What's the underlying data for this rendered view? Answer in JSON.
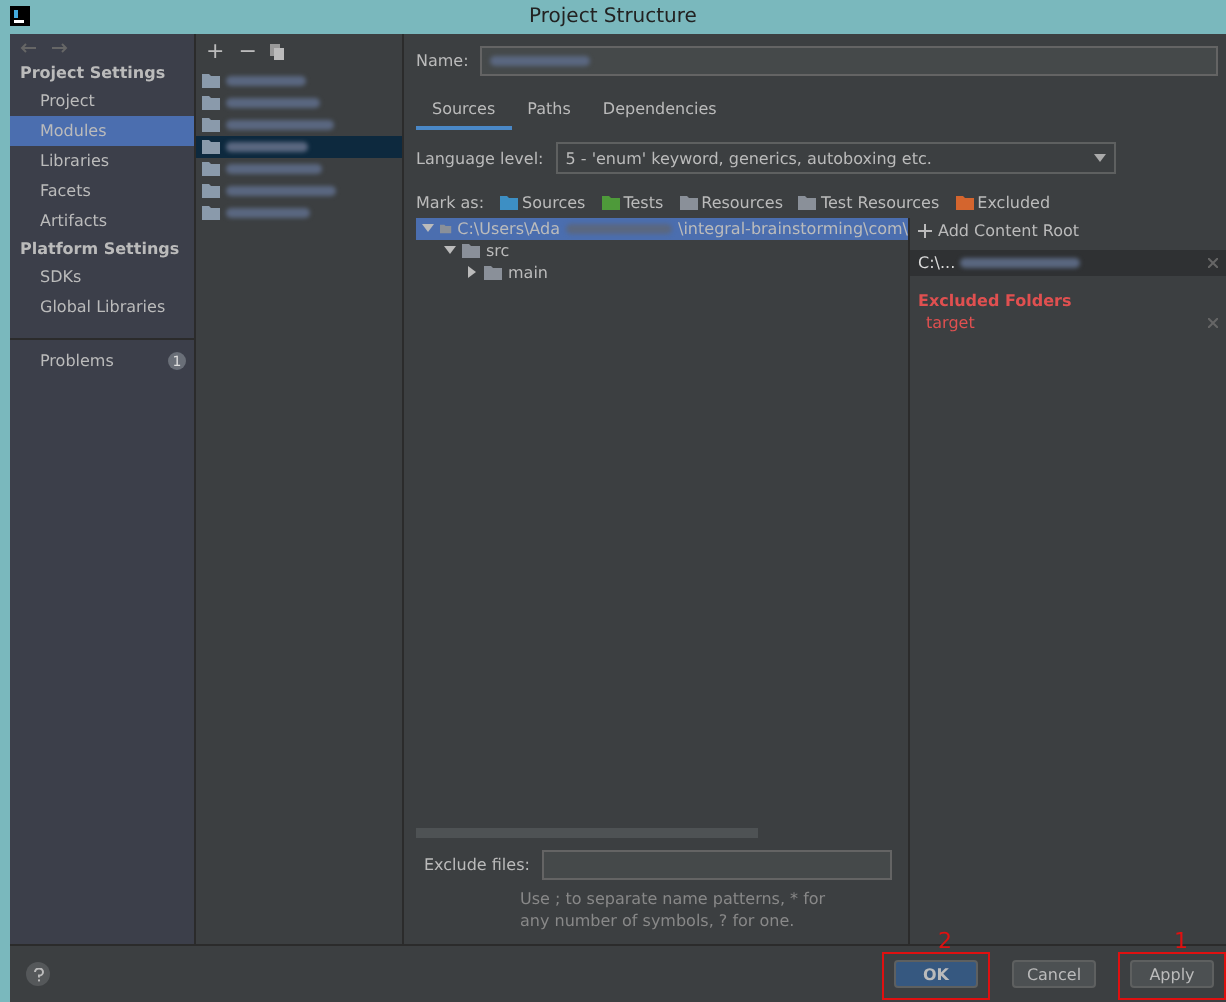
{
  "window": {
    "title": "Project Structure"
  },
  "sidebar": {
    "sections": [
      {
        "title": "Project Settings",
        "items": [
          {
            "label": "Project",
            "selected": false
          },
          {
            "label": "Modules",
            "selected": true
          },
          {
            "label": "Libraries",
            "selected": false
          },
          {
            "label": "Facets",
            "selected": false
          },
          {
            "label": "Artifacts",
            "selected": false
          }
        ]
      },
      {
        "title": "Platform Settings",
        "items": [
          {
            "label": "SDKs",
            "selected": false
          },
          {
            "label": "Global Libraries",
            "selected": false
          }
        ]
      }
    ],
    "problems": {
      "label": "Problems",
      "count": "1"
    }
  },
  "modules": {
    "toolbar": [
      "+",
      "−"
    ],
    "items": [
      {
        "selected": false
      },
      {
        "selected": false
      },
      {
        "selected": false
      },
      {
        "selected": true
      },
      {
        "selected": false
      },
      {
        "selected": false
      },
      {
        "selected": false
      }
    ]
  },
  "name_label": "Name:",
  "tabs": [
    {
      "label": "Sources",
      "selected": true
    },
    {
      "label": "Paths",
      "selected": false
    },
    {
      "label": "Dependencies",
      "selected": false
    }
  ],
  "language_level": {
    "label": "Language level:",
    "value": "5 - 'enum' keyword, generics, autoboxing etc."
  },
  "mark_as": {
    "label": "Mark as:",
    "items": [
      {
        "label": "Sources",
        "color": "#3d8fc4"
      },
      {
        "label": "Tests",
        "color": "#4e9a3a"
      },
      {
        "label": "Resources",
        "color": "#8a9099"
      },
      {
        "label": "Test Resources",
        "color": "#8a9099"
      },
      {
        "label": "Excluded",
        "color": "#d4652e"
      }
    ]
  },
  "tree": {
    "root": {
      "prefix": "C:\\Users\\Ada",
      "suffix": "\\integral-brainstorming\\com\\",
      "expanded": true,
      "selected": true,
      "children": [
        {
          "label": "src",
          "expanded": true,
          "children": [
            {
              "label": "main",
              "expanded": false
            }
          ]
        }
      ]
    }
  },
  "content_root": {
    "add_label": "Add Content Root",
    "path_prefix": "C:\\...",
    "excluded_title": "Excluded Folders",
    "excluded": [
      "target"
    ]
  },
  "exclude_files": {
    "label": "Exclude files:",
    "hint": "Use ; to separate name patterns, * for any number of symbols, ? for one."
  },
  "buttons": [
    {
      "label": "OK",
      "default": true,
      "annotation": "2"
    },
    {
      "label": "Cancel",
      "default": false
    },
    {
      "label": "Apply",
      "default": false,
      "annotation": "1"
    }
  ]
}
